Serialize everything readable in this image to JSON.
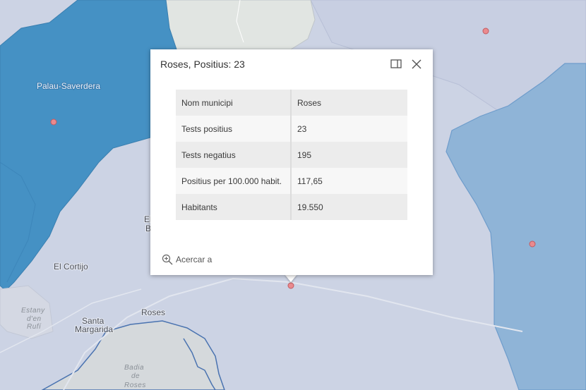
{
  "map": {
    "labels": {
      "palau_saverdera": "Palau-Saverdera",
      "el_cortijo": "El Cortijo",
      "roses": "Roses",
      "santa_margarida_1": "Santa",
      "santa_margarida_2": "Margarida",
      "estany_1": "Estany",
      "estany_2": "d'en",
      "estany_3": "Rufí",
      "badia_1": "Badia",
      "badia_2": "de",
      "badia_3": "Roses",
      "partial_1": "El",
      "partial_2": "B"
    },
    "colors": {
      "dark_polygon": "#4591c4",
      "light_polygon": "#8fb4d7",
      "land": "#ccd3e4",
      "water": "#d5d9dc",
      "marker": "#ea8a8e"
    },
    "markers": [
      {
        "name": "Palau-Saverdera"
      },
      {
        "name": "north-east"
      },
      {
        "name": "east"
      },
      {
        "name": "Roses"
      }
    ]
  },
  "popup": {
    "title": "Roses, Positius: 23",
    "dock_icon": "dock-side-icon",
    "close_icon": "close-icon",
    "rows": [
      {
        "attr": "Nom municipi",
        "value": "Roses"
      },
      {
        "attr": "Tests positius",
        "value": "23"
      },
      {
        "attr": "Tests negatius",
        "value": "195"
      },
      {
        "attr": "Positius per 100.000 habit.",
        "value": "117,65"
      },
      {
        "attr": "Habitants",
        "value": "19.550"
      }
    ],
    "zoom_action": "Acercar a",
    "zoom_icon": "zoom-in-icon"
  }
}
